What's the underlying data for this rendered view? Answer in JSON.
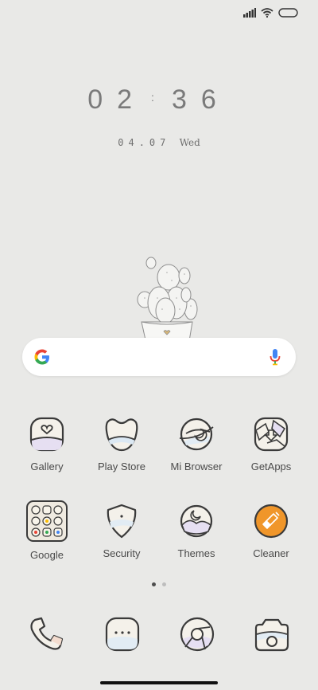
{
  "clock": {
    "hours": "02",
    "minutes": "36",
    "separator": ":"
  },
  "date": {
    "digits": "04.07",
    "weekday": "Wed"
  },
  "search": {
    "placeholder": ""
  },
  "apps_row1": [
    {
      "label": "Gallery",
      "icon": "gallery-icon"
    },
    {
      "label": "Play Store",
      "icon": "play-store-icon"
    },
    {
      "label": "Mi Browser",
      "icon": "mi-browser-icon"
    },
    {
      "label": "GetApps",
      "icon": "getapps-icon"
    }
  ],
  "apps_row2": [
    {
      "label": "Google",
      "icon": "google-folder-icon"
    },
    {
      "label": "Security",
      "icon": "security-icon"
    },
    {
      "label": "Themes",
      "icon": "themes-icon"
    },
    {
      "label": "Cleaner",
      "icon": "cleaner-icon"
    }
  ],
  "dock": [
    {
      "icon": "phone-icon"
    },
    {
      "icon": "messages-icon"
    },
    {
      "icon": "chrome-icon"
    },
    {
      "icon": "camera-icon"
    }
  ],
  "pager": {
    "pages": 2,
    "active": 1
  },
  "colors": {
    "background": "#e9e9e7",
    "cleaner_accent": "#f0962a",
    "icon_stroke": "#3a3a3a"
  }
}
